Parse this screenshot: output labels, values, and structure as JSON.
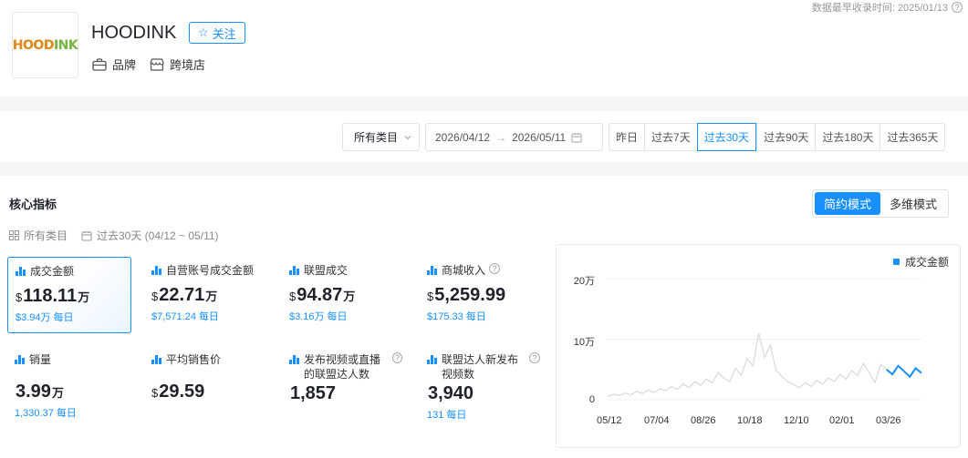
{
  "brand": {
    "logo_text_a": "HOOD",
    "logo_text_b": "INK",
    "name": "HOODINK",
    "follow_label": "关注",
    "tags": [
      "品牌",
      "跨境店"
    ],
    "record_label": "数据最早收录时间: 2025/01/13"
  },
  "filters": {
    "category": "所有类目",
    "date_start": "2026/04/12",
    "date_arrow": "→",
    "date_end": "2026/05/11",
    "periods": [
      "昨日",
      "过去7天",
      "过去30天",
      "过去90天",
      "过去180天",
      "过去365天"
    ],
    "active_period": "过去30天"
  },
  "core": {
    "title": "核心指标",
    "modes": [
      "简约模式",
      "多维模式"
    ],
    "active_mode": "简约模式",
    "crumb_category": "所有类目",
    "crumb_period": "过去30天 (04/12 ~ 05/11)"
  },
  "metrics": [
    {
      "label": "成交金额",
      "currency": "$",
      "value": "118.11",
      "unit": "万",
      "sub": "$3.94万",
      "daily": "每日"
    },
    {
      "label": "自营账号成交金额",
      "currency": "$",
      "value": "22.71",
      "unit": "万",
      "sub": "$7,571.24",
      "daily": "每日"
    },
    {
      "label": "联盟成交",
      "currency": "$",
      "value": "94.87",
      "unit": "万",
      "sub": "$3.16万",
      "daily": "每日"
    },
    {
      "label": "商城收入",
      "currency": "$",
      "value": "5,259.99",
      "unit": "",
      "sub": "$175.33",
      "daily": "每日"
    },
    {
      "label": "销量",
      "currency": "",
      "value": "3.99",
      "unit": "万",
      "sub": "1,330.37",
      "daily": "每日"
    },
    {
      "label": "平均销售价",
      "currency": "$",
      "value": "29.59",
      "unit": "",
      "sub": "",
      "daily": ""
    },
    {
      "label": "发布视频或直播的联盟达人数",
      "currency": "",
      "value": "1,857",
      "unit": "",
      "sub": "",
      "daily": ""
    },
    {
      "label": "联盟达人新发布视频数",
      "currency": "",
      "value": "3,940",
      "unit": "",
      "sub": "131",
      "daily": "每日"
    }
  ],
  "colors": {
    "accent": "#1890ff",
    "history_line": "#d9d9d9"
  },
  "chart_data": {
    "type": "line",
    "legend": [
      "成交金额"
    ],
    "y_ticks": [
      "20万",
      "10万",
      "0"
    ],
    "ylim": [
      0,
      200000
    ],
    "x_ticks": [
      "05/12",
      "07/04",
      "08/26",
      "10/18",
      "12/10",
      "02/01",
      "03/26"
    ],
    "series": [
      {
        "name": "成交金额",
        "values": [
          6000,
          9000,
          7000,
          11000,
          8000,
          14000,
          10000,
          16000,
          12000,
          18000,
          15000,
          22000,
          17000,
          26000,
          20000,
          30000,
          24000,
          34000,
          28000,
          45000,
          36000,
          30000,
          52000,
          40000,
          68000,
          56000,
          110000,
          70000,
          90000,
          48000,
          38000,
          30000,
          25000,
          20000,
          28000,
          22000,
          32000,
          26000,
          36000,
          30000,
          42000,
          34000,
          48000,
          40000,
          60000,
          45000,
          28000,
          58000,
          50000,
          42000,
          56000,
          47000,
          38000,
          52000,
          44000
        ]
      }
    ]
  }
}
